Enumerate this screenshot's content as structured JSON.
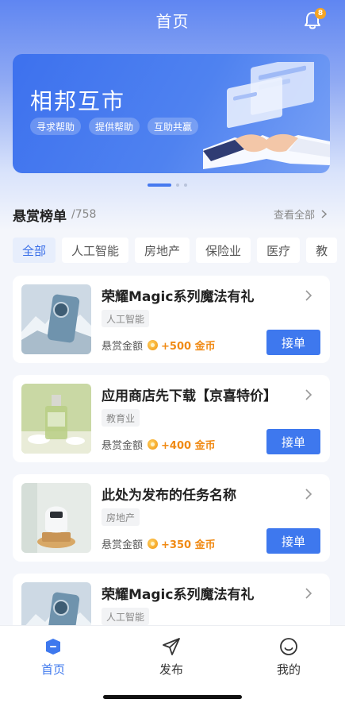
{
  "header": {
    "title": "首页",
    "notification_count": "8"
  },
  "banner": {
    "title": "相邦互市",
    "tags": [
      "寻求帮助",
      "提供帮助",
      "互助共赢"
    ]
  },
  "bounty": {
    "title": "悬赏榜单",
    "count": "/758",
    "view_all": "查看全部"
  },
  "filters": [
    "全部",
    "人工智能",
    "房地产",
    "保险业",
    "医疗",
    "教"
  ],
  "cards": [
    {
      "title": "荣耀Magic系列魔法有礼",
      "tag": "人工智能",
      "reward_label": "悬赏金额",
      "reward": "+500 金币",
      "button": "接单",
      "thumb": "phone-product"
    },
    {
      "title": "应用商店先下载【京喜特价】",
      "tag": "教育业",
      "reward_label": "悬赏金额",
      "reward": "+400 金币",
      "button": "接单",
      "thumb": "perfume-bottle"
    },
    {
      "title": "此处为发布的任务名称",
      "tag": "房地产",
      "reward_label": "悬赏金额",
      "reward": "+350 金币",
      "button": "接单",
      "thumb": "smart-speaker"
    },
    {
      "title": "荣耀Magic系列魔法有礼",
      "tag": "人工智能",
      "reward_label": "",
      "reward": "",
      "button": "",
      "thumb": "phone-product"
    }
  ],
  "tabbar": [
    {
      "label": "首页",
      "icon": "home-icon",
      "active": true
    },
    {
      "label": "发布",
      "icon": "send-icon",
      "active": false
    },
    {
      "label": "我的",
      "icon": "smile-icon",
      "active": false
    }
  ],
  "colors": {
    "primary": "#3e78ee",
    "reward": "#f08a14"
  }
}
